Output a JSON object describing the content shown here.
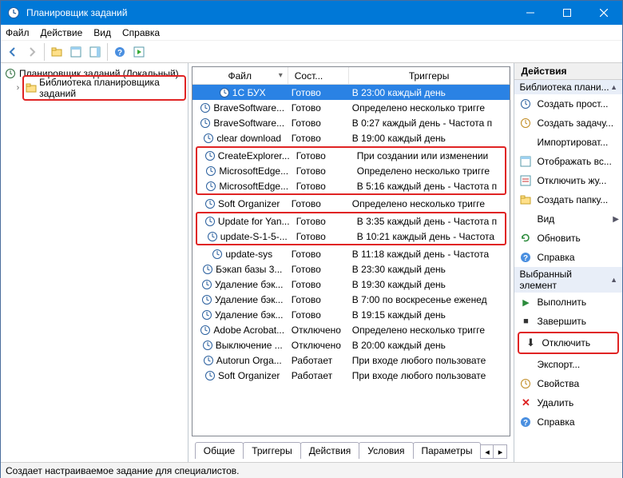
{
  "window": {
    "title": "Планировщик заданий"
  },
  "menu": {
    "file": "Файл",
    "action": "Действие",
    "view": "Вид",
    "help": "Справка"
  },
  "tree": {
    "root": "Планировщик заданий (Локальный)",
    "lib": "Библиотека планировщика заданий"
  },
  "columns": {
    "file": "Файл",
    "state": "Сост...",
    "trigger": "Триггеры"
  },
  "tasks": [
    {
      "name": "1С БУХ",
      "state": "Готово",
      "trigger": "В 23:00 каждый день",
      "selected": true
    },
    {
      "name": "BraveSoftware...",
      "state": "Готово",
      "trigger": "Определено несколько тригге"
    },
    {
      "name": "BraveSoftware...",
      "state": "Готово",
      "trigger": "В 0:27 каждый день - Частота п"
    },
    {
      "name": "clear download",
      "state": "Готово",
      "trigger": "В 19:00 каждый день"
    },
    {
      "name": "CreateExplorer...",
      "state": "Готово",
      "trigger": "При создании или изменении",
      "group": 1
    },
    {
      "name": "MicrosoftEdge...",
      "state": "Готово",
      "trigger": "Определено несколько тригге",
      "group": 1
    },
    {
      "name": "MicrosoftEdge...",
      "state": "Готово",
      "trigger": "В 5:16 каждый день - Частота п",
      "group": 1
    },
    {
      "name": "Soft Organizer",
      "state": "Готово",
      "trigger": "Определено несколько тригге"
    },
    {
      "name": "Update for Yan...",
      "state": "Готово",
      "trigger": "В 3:35 каждый день - Частота п",
      "group": 2
    },
    {
      "name": "update-S-1-5-...",
      "state": "Готово",
      "trigger": "В 10:21 каждый день - Частота",
      "group": 2
    },
    {
      "name": "update-sys",
      "state": "Готово",
      "trigger": "В 11:18 каждый день - Частота"
    },
    {
      "name": "Бэкап базы 3...",
      "state": "Готово",
      "trigger": "В 23:30 каждый день"
    },
    {
      "name": "Удаление бэк...",
      "state": "Готово",
      "trigger": "В 19:30 каждый день"
    },
    {
      "name": "Удаление бэк...",
      "state": "Готово",
      "trigger": "В 7:00 по воскресенье еженед"
    },
    {
      "name": "Удаление бэк...",
      "state": "Готово",
      "trigger": "В 19:15 каждый день"
    },
    {
      "name": "Adobe Acrobat...",
      "state": "Отключено",
      "trigger": "Определено несколько тригге"
    },
    {
      "name": "Выключение ...",
      "state": "Отключено",
      "trigger": "В 20:00 каждый день"
    },
    {
      "name": "Autorun Orga...",
      "state": "Работает",
      "trigger": "При входе любого пользовате"
    },
    {
      "name": "Soft Organizer",
      "state": "Работает",
      "trigger": "При входе любого пользовате"
    }
  ],
  "tabs": {
    "general": "Общие",
    "triggers": "Триггеры",
    "actions": "Действия",
    "conditions": "Условия",
    "params": "Параметры"
  },
  "actions": {
    "header": "Действия",
    "group1": "Библиотека плани...",
    "items1": [
      {
        "label": "Создать прост...",
        "icon": "clock"
      },
      {
        "label": "Создать задачу...",
        "icon": "clocknew"
      },
      {
        "label": "Импортироват...",
        "icon": ""
      },
      {
        "label": "Отображать вс...",
        "icon": "panel"
      },
      {
        "label": "Отключить жу...",
        "icon": "log"
      },
      {
        "label": "Создать папку...",
        "icon": "folder"
      },
      {
        "label": "Вид",
        "icon": "",
        "arrow": true
      },
      {
        "label": "Обновить",
        "icon": "refresh"
      },
      {
        "label": "Справка",
        "icon": "help"
      }
    ],
    "group2": "Выбранный элемент",
    "items2": [
      {
        "label": "Выполнить",
        "icon": "play"
      },
      {
        "label": "Завершить",
        "icon": "stop"
      },
      {
        "label": "Отключить",
        "icon": "disable",
        "highlight": true
      },
      {
        "label": "Экспорт...",
        "icon": ""
      },
      {
        "label": "Свойства",
        "icon": "props"
      },
      {
        "label": "Удалить",
        "icon": "delete"
      },
      {
        "label": "Справка",
        "icon": "help"
      }
    ]
  },
  "status": "Создает настраиваемое задание для специалистов."
}
